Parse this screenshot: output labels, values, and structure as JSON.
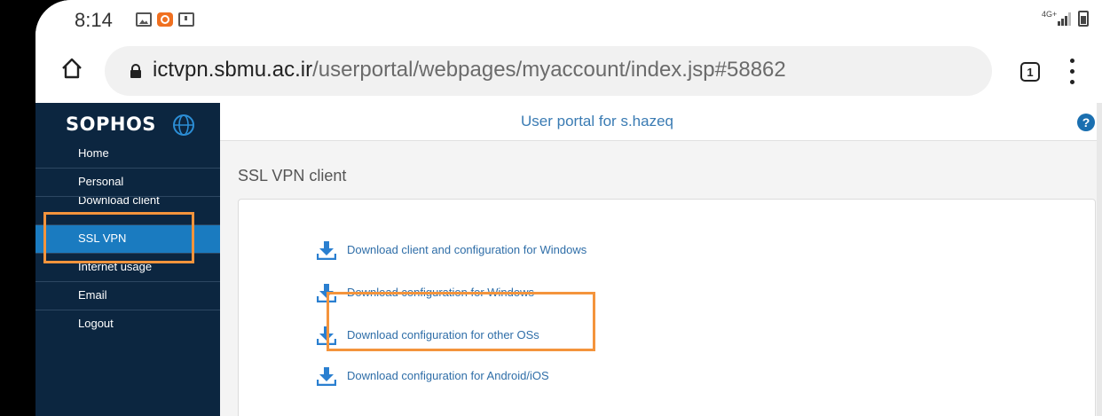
{
  "status_bar": {
    "time": "8:14",
    "network": "4G+",
    "icons": [
      "gallery-icon",
      "app-notification-icon",
      "square-notification-icon",
      "signal-icon",
      "battery-icon"
    ]
  },
  "browser": {
    "url_domain": "ictvpn.sbmu.ac.ir",
    "url_path": "/userportal/webpages/myaccount/index.jsp#58862",
    "tab_count": "1"
  },
  "logo": {
    "text": "SOPHOS"
  },
  "header": {
    "title": "User portal for s.hazeq",
    "help": "?"
  },
  "sidebar": {
    "items": [
      {
        "label": "Home"
      },
      {
        "label": "Personal"
      },
      {
        "label": "Download client"
      },
      {
        "label": "SSL VPN",
        "active": true
      },
      {
        "label": "Internet usage"
      },
      {
        "label": "Email"
      },
      {
        "label": "Logout"
      }
    ]
  },
  "main": {
    "section_title": "SSL VPN client",
    "links": [
      {
        "label": "Download client and configuration for Windows"
      },
      {
        "label": "Download configuration for Windows"
      },
      {
        "label": "Download configuration for other OSs"
      },
      {
        "label": "Download configuration for Android/iOS"
      }
    ]
  },
  "colors": {
    "sidebar_bg": "#0c2640",
    "active_item": "#1a7bc0",
    "link": "#2f6ea8",
    "highlight": "#f4943c"
  }
}
